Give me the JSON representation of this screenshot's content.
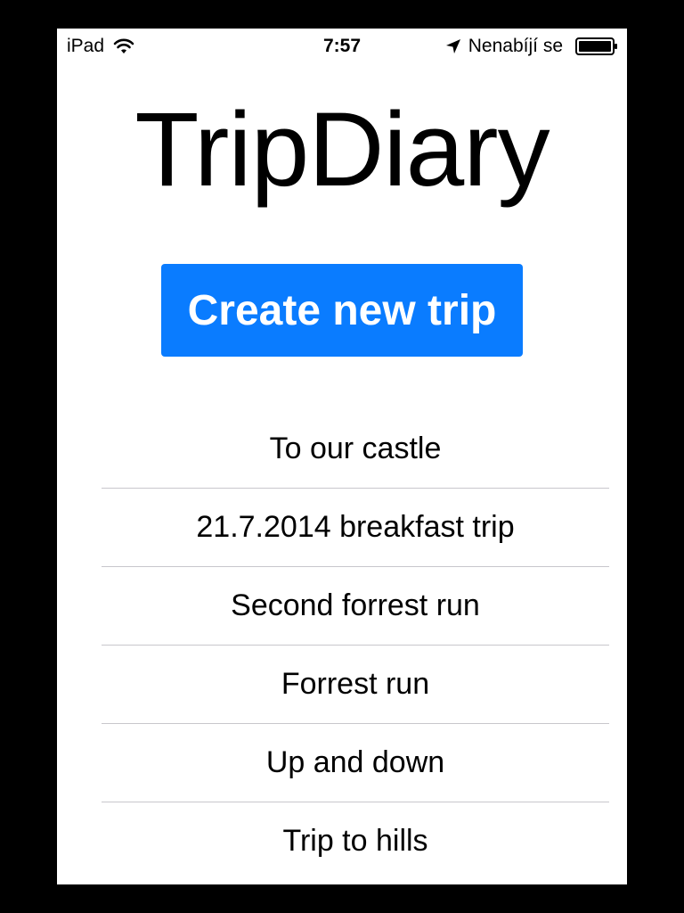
{
  "status_bar": {
    "carrier": "iPad",
    "time": "7:57",
    "charging_status": "Nenabíjí se",
    "icons": [
      "wifi-icon",
      "location-icon",
      "battery-icon"
    ]
  },
  "app": {
    "title": "TripDiary"
  },
  "create_button": {
    "label": "Create new trip",
    "color": "#0a7cff"
  },
  "trips": [
    {
      "label": "To our castle"
    },
    {
      "label": "21.7.2014 breakfast trip"
    },
    {
      "label": "Second forrest run"
    },
    {
      "label": "Forrest run"
    },
    {
      "label": "Up and down"
    },
    {
      "label": "Trip to hills"
    }
  ]
}
